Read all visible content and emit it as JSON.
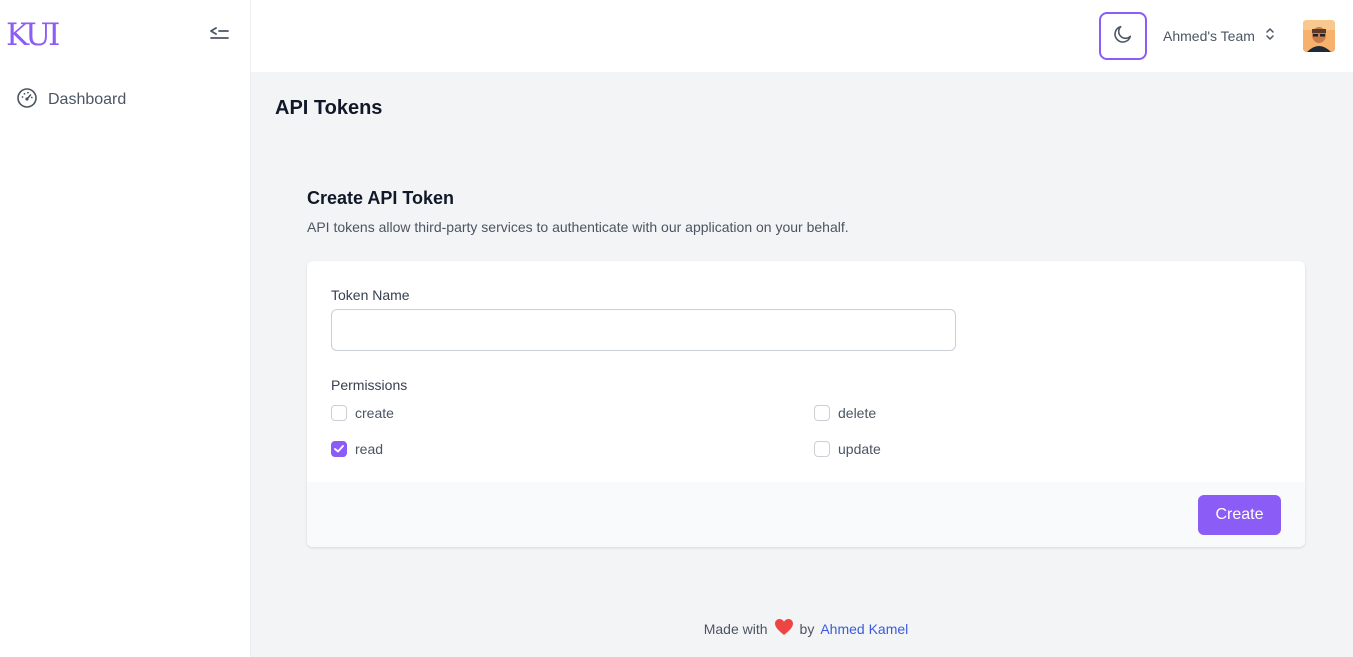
{
  "brand": {
    "logo_text": "KUI",
    "accent_color": "#8b5cf6"
  },
  "sidebar": {
    "collapse_icon": "collapse-left-icon",
    "items": [
      {
        "label": "Dashboard",
        "icon": "dashboard-gauge-icon"
      }
    ]
  },
  "topbar": {
    "theme_toggle_icon": "moon-icon",
    "team_name": "Ahmed's Team",
    "team_select_icon": "chevron-up-down-icon",
    "avatar_icon": "user-avatar"
  },
  "page": {
    "title": "API Tokens"
  },
  "create_token": {
    "title": "Create API Token",
    "description": "API tokens allow third-party services to authenticate with our application on your behalf.",
    "token_name_label": "Token Name",
    "token_name_value": "",
    "permissions_label": "Permissions",
    "permissions": [
      {
        "label": "create",
        "checked": false
      },
      {
        "label": "delete",
        "checked": false
      },
      {
        "label": "read",
        "checked": true
      },
      {
        "label": "update",
        "checked": false
      }
    ],
    "submit_label": "Create"
  },
  "footer": {
    "prefix": "Made with",
    "heart_icon": "heart-icon",
    "by": "by",
    "author": "Ahmed Kamel",
    "heart_color": "#ef4444"
  }
}
